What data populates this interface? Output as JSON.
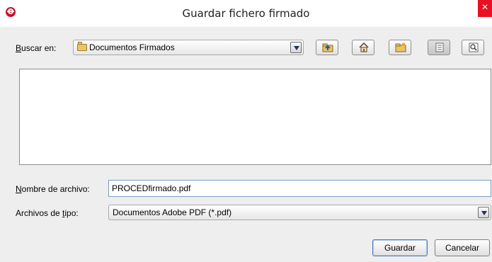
{
  "window": {
    "title": "Guardar fichero firmado",
    "close_glyph": "×"
  },
  "lookin": {
    "label": "Buscar en:",
    "label_mnemonic": "B",
    "label_rest": "uscar en:",
    "value": "Documentos Firmados"
  },
  "toolbar": {
    "buttons": [
      {
        "name": "up-one-level-button",
        "icon": "folder-up-icon"
      },
      {
        "name": "home-button",
        "icon": "home-icon"
      },
      {
        "name": "new-folder-button",
        "icon": "new-folder-icon"
      },
      {
        "name": "list-view-button",
        "icon": "list-view-icon",
        "selected": true
      },
      {
        "name": "details-view-button",
        "icon": "details-view-icon"
      }
    ]
  },
  "filename": {
    "label_mnemonic": "N",
    "label_rest": "ombre de archivo:",
    "value": "PROCEDfirmado.pdf"
  },
  "filetype": {
    "label_pre": "Archivos de ",
    "label_mnemonic": "t",
    "label_post": "ipo:",
    "value": "Documentos Adobe PDF (*.pdf)"
  },
  "buttons": {
    "save": "Guardar",
    "cancel": "Cancelar"
  },
  "colors": {
    "accent_close": "#e81123",
    "app_icon": "#c8102e",
    "focus_border": "#7a9cc7"
  }
}
